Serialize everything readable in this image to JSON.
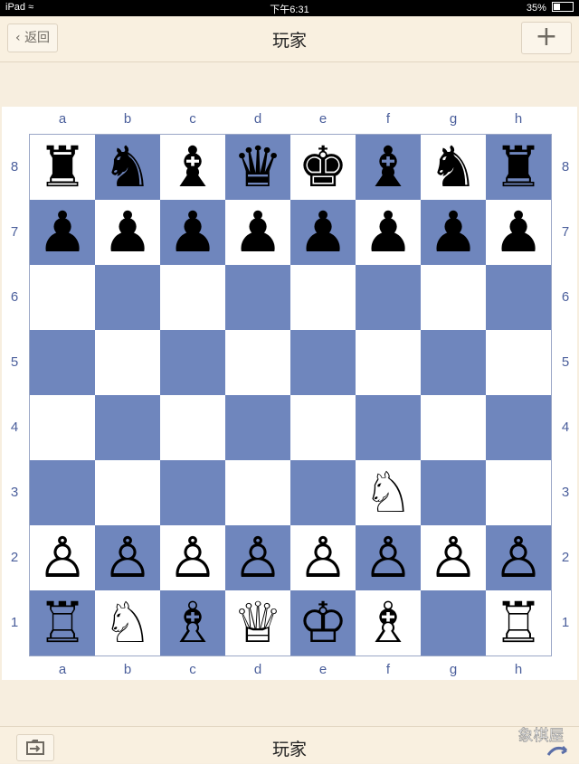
{
  "status_bar": {
    "device": "iPad",
    "time": "下午6:31",
    "battery_text": "35%",
    "battery_level": 0.35
  },
  "nav": {
    "back_label": "返回",
    "title": "玩家",
    "add_label": "+"
  },
  "board": {
    "files": [
      "a",
      "b",
      "c",
      "d",
      "e",
      "f",
      "g",
      "h"
    ],
    "ranks": [
      "8",
      "7",
      "6",
      "5",
      "4",
      "3",
      "2",
      "1"
    ],
    "light_color": "#ffffff",
    "dark_color": "#6f86bd",
    "position": [
      [
        "r",
        "n",
        "b",
        "q",
        "k",
        "b",
        "n",
        "r"
      ],
      [
        "p",
        "p",
        "p",
        "p",
        "p",
        "p",
        "p",
        "p"
      ],
      [
        "",
        "",
        "",
        "",
        "",
        "",
        "",
        ""
      ],
      [
        "",
        "",
        "",
        "",
        "",
        "",
        "",
        ""
      ],
      [
        "",
        "",
        "",
        "",
        "",
        "",
        "",
        ""
      ],
      [
        "",
        "",
        "",
        "",
        "",
        "N",
        "",
        ""
      ],
      [
        "P",
        "P",
        "P",
        "P",
        "P",
        "P",
        "P",
        "P"
      ],
      [
        "R",
        "N",
        "B",
        "Q",
        "K",
        "B",
        "",
        "R"
      ]
    ]
  },
  "bottom": {
    "title": "玩家",
    "left_icon": "folder-export-icon"
  },
  "watermark": {
    "text": "象棋屋"
  }
}
